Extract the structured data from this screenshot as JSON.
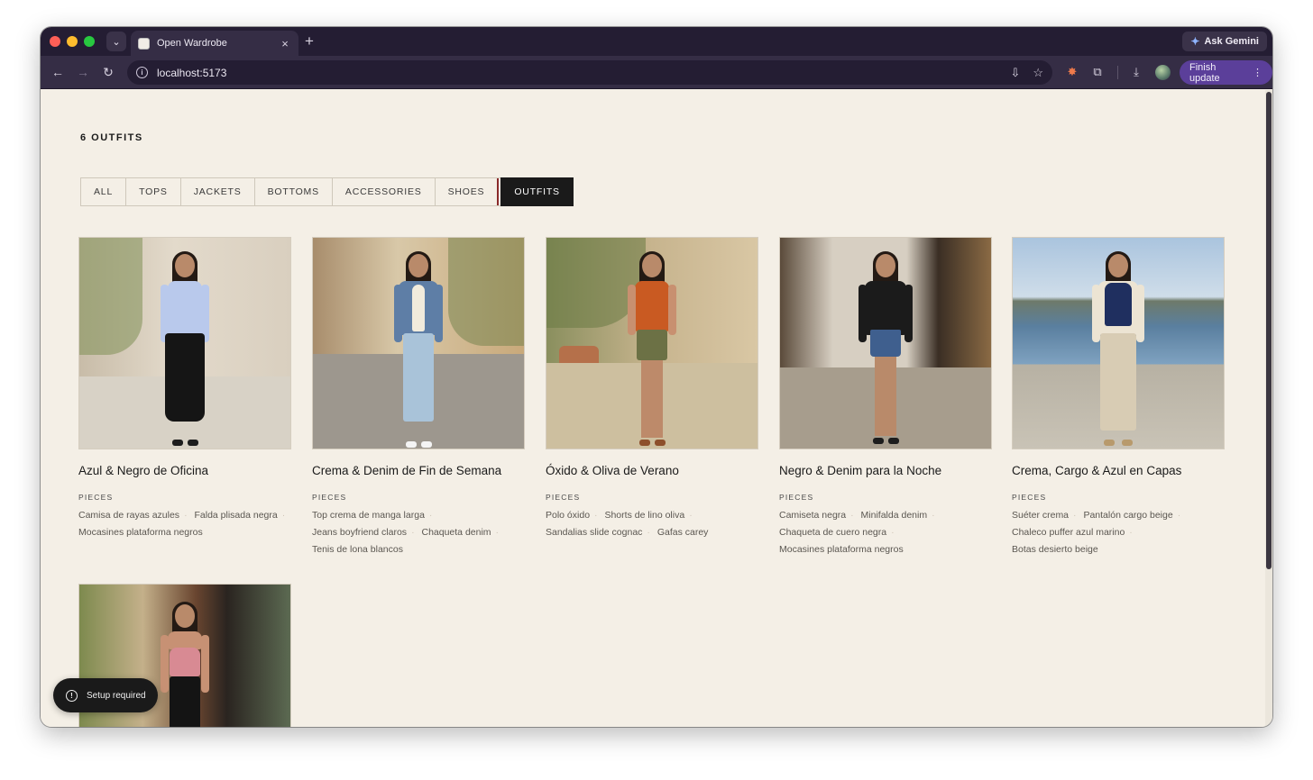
{
  "browser": {
    "tab_title": "Open Wardrobe",
    "tab_close": "×",
    "new_tab": "+",
    "ask_gemini": "Ask Gemini",
    "url": "localhost:5173",
    "finish_update": "Finish update",
    "icons": [
      "chevron-down-icon",
      "back-icon",
      "forward-icon",
      "reload-icon",
      "info-icon",
      "install-icon",
      "star-icon",
      "extension-icon",
      "puzzle-icon",
      "download-icon",
      "kebab-icon"
    ]
  },
  "page": {
    "count_label": "6 OUTFITS",
    "filters": [
      {
        "label": "ALL",
        "active": false
      },
      {
        "label": "TOPS",
        "active": false
      },
      {
        "label": "JACKETS",
        "active": false
      },
      {
        "label": "BOTTOMS",
        "active": false
      },
      {
        "label": "ACCESSORIES",
        "active": false
      },
      {
        "label": "SHOES",
        "active": false
      },
      {
        "label": "OUTFITS",
        "active": true
      }
    ],
    "pieces_label": "PIECES",
    "outfits": [
      {
        "title": "Azul & Negro de Oficina",
        "pieces": [
          "Camisa de rayas azules",
          "Falda plisada negra",
          "Mocasines plataforma negros"
        ]
      },
      {
        "title": "Crema & Denim de Fin de Semana",
        "pieces": [
          "Top crema de manga larga",
          "Jeans boyfriend claros",
          "Chaqueta denim",
          "Tenis de lona blancos"
        ]
      },
      {
        "title": "Óxido & Oliva de Verano",
        "pieces": [
          "Polo óxido",
          "Shorts de lino oliva",
          "Sandalias slide cognac",
          "Gafas carey"
        ]
      },
      {
        "title": "Negro & Denim para la Noche",
        "pieces": [
          "Camiseta negra",
          "Minifalda denim",
          "Chaqueta de cuero negra",
          "Mocasines plataforma negros"
        ]
      },
      {
        "title": "Crema, Cargo & Azul en Capas",
        "pieces": [
          "Suéter crema",
          "Pantalón cargo beige",
          "Chaleco puffer azul marino",
          "Botas desierto beige"
        ]
      },
      {
        "title": "",
        "pieces": []
      }
    ],
    "toast": "Setup required"
  },
  "colors": {
    "page_bg": "#f4efe6",
    "browser_frame": "#241d33",
    "toolbar": "#352d45",
    "active_filter": "#1a1a1a",
    "finish_update_bg": "#5b3f9a"
  }
}
